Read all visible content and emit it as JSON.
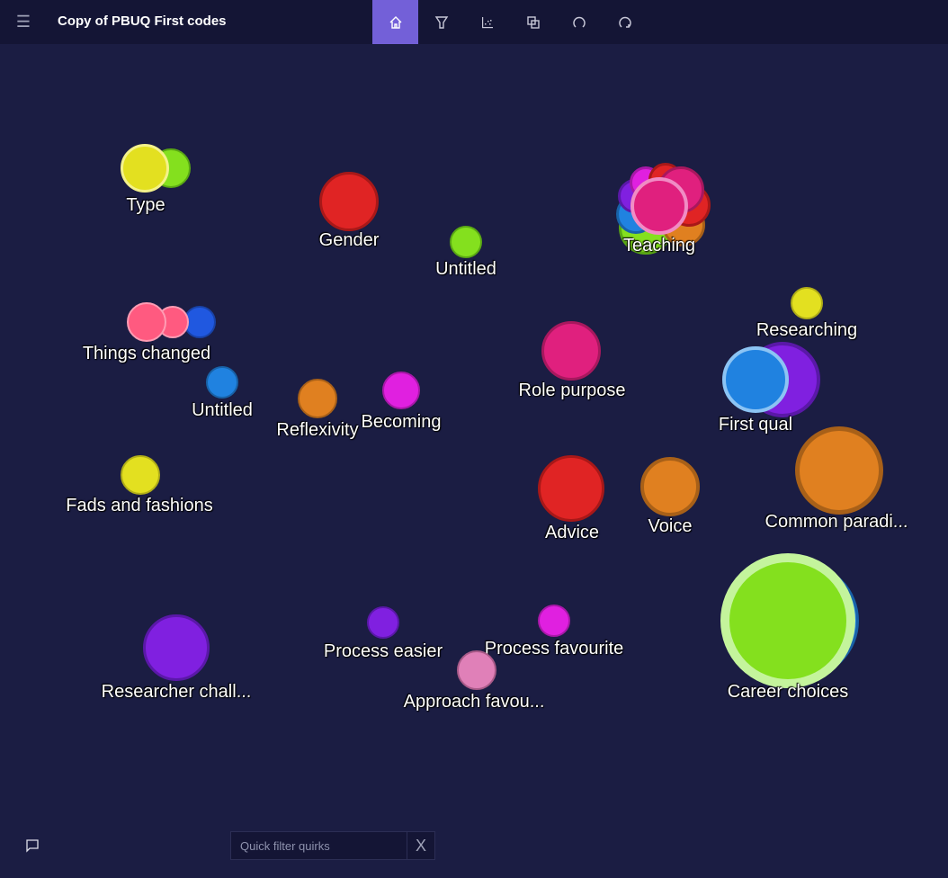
{
  "header": {
    "title": "Copy of PBUQ First codes",
    "menu_icon": "hamburger-icon",
    "toolbar": [
      {
        "name": "home",
        "icon": "home-icon",
        "active": true
      },
      {
        "name": "filter",
        "icon": "filter-icon",
        "active": false
      },
      {
        "name": "chart",
        "icon": "scatter-chart-icon",
        "active": false
      },
      {
        "name": "layers",
        "icon": "overlap-squares-icon",
        "active": false
      },
      {
        "name": "undo",
        "icon": "undo-icon",
        "active": false
      },
      {
        "name": "redo",
        "icon": "redo-icon",
        "active": false
      }
    ]
  },
  "colors": {
    "background": "#1b1d43",
    "topbar": "#141535",
    "accent": "#7360d8"
  },
  "clusters": [
    {
      "label": "Type",
      "bubbles": [
        {
          "color": "#84e01e",
          "border": "#5aa814"
        },
        {
          "color": "#e3e020",
          "border": "#f4f28a"
        }
      ]
    },
    {
      "label": "Gender",
      "bubbles": [
        {
          "color": "#e02424",
          "border": "#a81818"
        }
      ]
    },
    {
      "label": "Untitled",
      "bubbles": [
        {
          "color": "#84e01e",
          "border": "#5aa814"
        }
      ]
    },
    {
      "label": "Teaching",
      "bubbles": [
        {
          "color": "#84e01e",
          "border": "#5aa814"
        },
        {
          "color": "#2082e0",
          "border": "#1862a8"
        },
        {
          "color": "#8020e0",
          "border": "#5a18a8"
        },
        {
          "color": "#e08020",
          "border": "#a86018"
        },
        {
          "color": "#e02424",
          "border": "#a81818"
        },
        {
          "color": "#e020e0",
          "border": "#a818a8"
        },
        {
          "color": "#e02424",
          "border": "#a81818"
        },
        {
          "color": "#e0207e",
          "border": "#a8185e"
        },
        {
          "color": "#e0207e",
          "border": "#f08cc4"
        }
      ]
    },
    {
      "label": "Researching",
      "bubbles": [
        {
          "color": "#e3e020",
          "border": "#b0ad18"
        }
      ]
    },
    {
      "label": "Things changed",
      "bubbles": [
        {
          "color": "#2058e0",
          "border": "#1842a8"
        },
        {
          "color": "#ff5a80",
          "border": "#ff9cb4"
        },
        {
          "color": "#ff5a80",
          "border": "#ff9cb4"
        }
      ]
    },
    {
      "label": "Untitled",
      "bubbles": [
        {
          "color": "#2082e0",
          "border": "#1862a8"
        }
      ]
    },
    {
      "label": "Reflexivity",
      "bubbles": [
        {
          "color": "#e08020",
          "border": "#a86018"
        }
      ]
    },
    {
      "label": "Becoming",
      "bubbles": [
        {
          "color": "#e020e0",
          "border": "#a818a8"
        }
      ]
    },
    {
      "label": "Role purpose",
      "bubbles": [
        {
          "color": "#e0207e",
          "border": "#a8185e"
        }
      ]
    },
    {
      "label": "First qual",
      "bubbles": [
        {
          "color": "#8020e0",
          "border": "#5a18a8"
        },
        {
          "color": "#2082e0",
          "border": "#8cc4f4"
        }
      ]
    },
    {
      "label": "Fads and fashions",
      "bubbles": [
        {
          "color": "#e3e020",
          "border": "#b0ad18"
        }
      ]
    },
    {
      "label": "Advice",
      "bubbles": [
        {
          "color": "#e02424",
          "border": "#a81818"
        }
      ]
    },
    {
      "label": "Voice",
      "bubbles": [
        {
          "color": "#e08020",
          "border": "#a86018"
        }
      ]
    },
    {
      "label": "Common paradi...",
      "bubbles": [
        {
          "color": "#e08020",
          "border": "#a86018"
        }
      ]
    },
    {
      "label": "Researcher chall...",
      "bubbles": [
        {
          "color": "#8020e0",
          "border": "#5a18a8"
        }
      ]
    },
    {
      "label": "Process easier",
      "bubbles": [
        {
          "color": "#8020e0",
          "border": "#5a18a8"
        }
      ]
    },
    {
      "label": "Process favourite",
      "bubbles": [
        {
          "color": "#e020e0",
          "border": "#a818a8"
        }
      ]
    },
    {
      "label": "Approach favou...",
      "bubbles": [
        {
          "color": "#e080b8",
          "border": "#a85a88"
        }
      ]
    },
    {
      "label": "Career choices",
      "bubbles": [
        {
          "color": "#2082e0",
          "border": "#1862a8"
        },
        {
          "color": "#84e01e",
          "border": "#c4f49c"
        }
      ]
    }
  ],
  "footer": {
    "feedback_icon": "comment-icon",
    "quick_filter": {
      "placeholder": "Quick filter quirks",
      "value": ""
    },
    "clear_label": "X"
  }
}
